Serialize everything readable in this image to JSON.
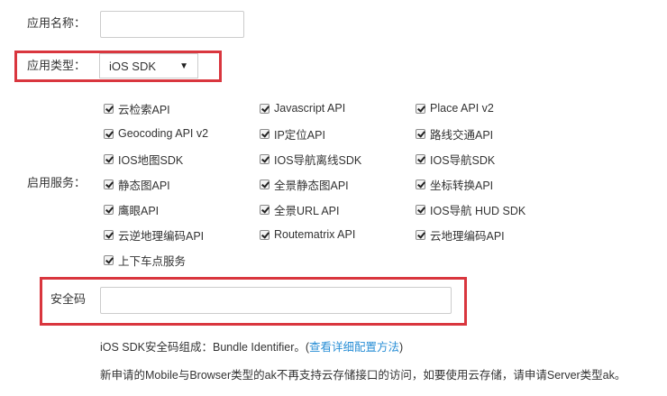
{
  "form": {
    "app_name_label": "应用名称：",
    "app_name_value": "",
    "app_type_label": "应用类型：",
    "app_type_value": "iOS SDK",
    "services_label": "启用服务：",
    "security_code_label": "安全码",
    "security_code_value": ""
  },
  "services": [
    {
      "label": "云检索API",
      "checked": true
    },
    {
      "label": "Javascript API",
      "checked": true
    },
    {
      "label": "Place API v2",
      "checked": true
    },
    {
      "label": "Geocoding API v2",
      "checked": true
    },
    {
      "label": "IP定位API",
      "checked": true
    },
    {
      "label": "路线交通API",
      "checked": true
    },
    {
      "label": "IOS地图SDK",
      "checked": true
    },
    {
      "label": "IOS导航离线SDK",
      "checked": true
    },
    {
      "label": "IOS导航SDK",
      "checked": true
    },
    {
      "label": "静态图API",
      "checked": true
    },
    {
      "label": "全景静态图API",
      "checked": true
    },
    {
      "label": "坐标转换API",
      "checked": true
    },
    {
      "label": "鹰眼API",
      "checked": true
    },
    {
      "label": "全景URL API",
      "checked": true
    },
    {
      "label": "IOS导航 HUD SDK",
      "checked": true
    },
    {
      "label": "云逆地理编码API",
      "checked": true
    },
    {
      "label": "Routematrix API",
      "checked": true
    },
    {
      "label": "云地理编码API",
      "checked": true
    },
    {
      "label": "上下车点服务",
      "checked": true
    }
  ],
  "notes": {
    "ios_sdk_prefix": "iOS SDK安全码组成：Bundle Identifier。(",
    "ios_sdk_link": "查看详细配置方法",
    "ios_sdk_suffix": ")",
    "cloud_storage": "新申请的Mobile与Browser类型的ak不再支持云存储接口的访问，如要使用云存储，请申请Server类型ak。"
  },
  "colors": {
    "highlight_border": "#d9363e",
    "link": "#2a8fd6"
  }
}
